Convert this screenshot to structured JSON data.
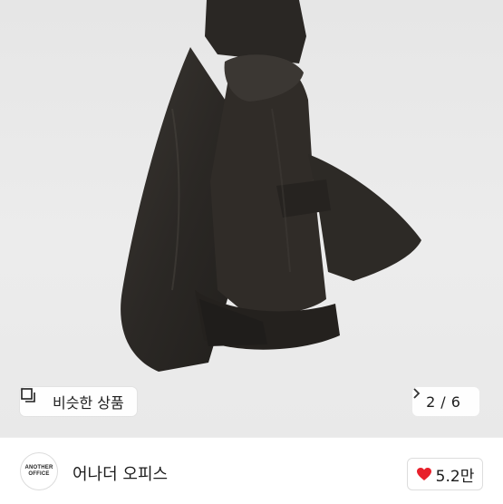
{
  "image": {
    "subject": "black-padded-jacket-photo"
  },
  "overlay": {
    "similar_label": "비슷한 상품",
    "similar_icon": "similar-items-icon",
    "pager_current": "2",
    "pager_separator": "/",
    "pager_total": "6",
    "pager_icon": "chevron-right-icon"
  },
  "shop": {
    "logo_line1": "ANOTHER",
    "logo_line2": "OFFICE",
    "name": "어나더 오피스",
    "likes": "5.2만",
    "like_icon": "heart-icon",
    "heart_color": "#e8202b"
  }
}
